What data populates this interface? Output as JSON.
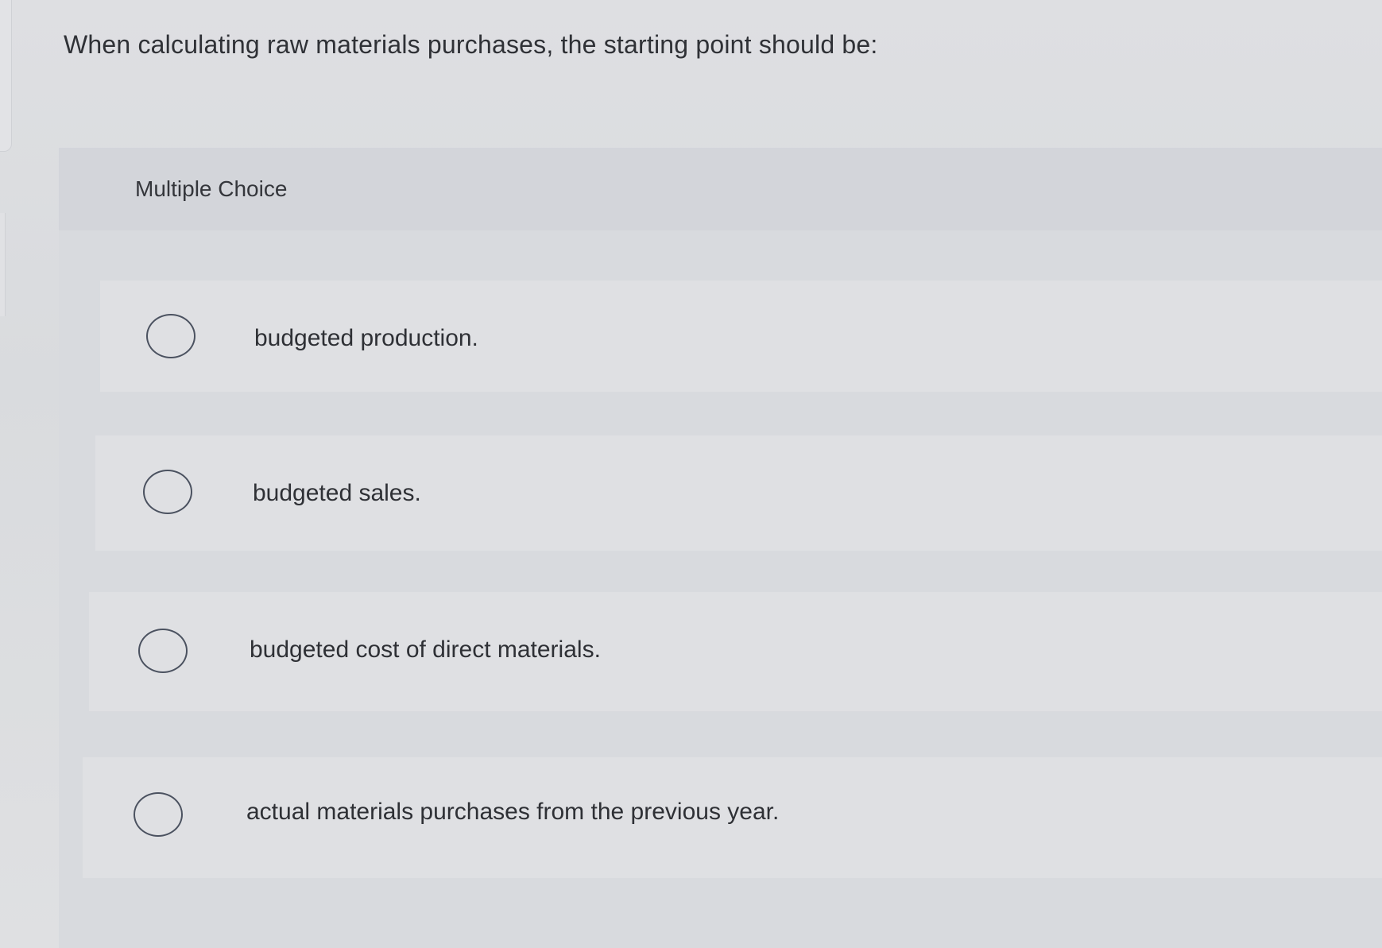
{
  "question": {
    "text": "When calculating raw materials purchases, the starting point should be:"
  },
  "section": {
    "label": "Multiple Choice"
  },
  "options": [
    {
      "label": "budgeted production.",
      "selected": false
    },
    {
      "label": "budgeted sales.",
      "selected": false
    },
    {
      "label": "budgeted cost of direct materials.",
      "selected": false
    },
    {
      "label": "actual materials purchases from the previous year.",
      "selected": false
    }
  ],
  "colors": {
    "background": "#dcdee1",
    "panel": "#d8dade",
    "radio_border": "#4b5260",
    "text": "#2e3035"
  }
}
